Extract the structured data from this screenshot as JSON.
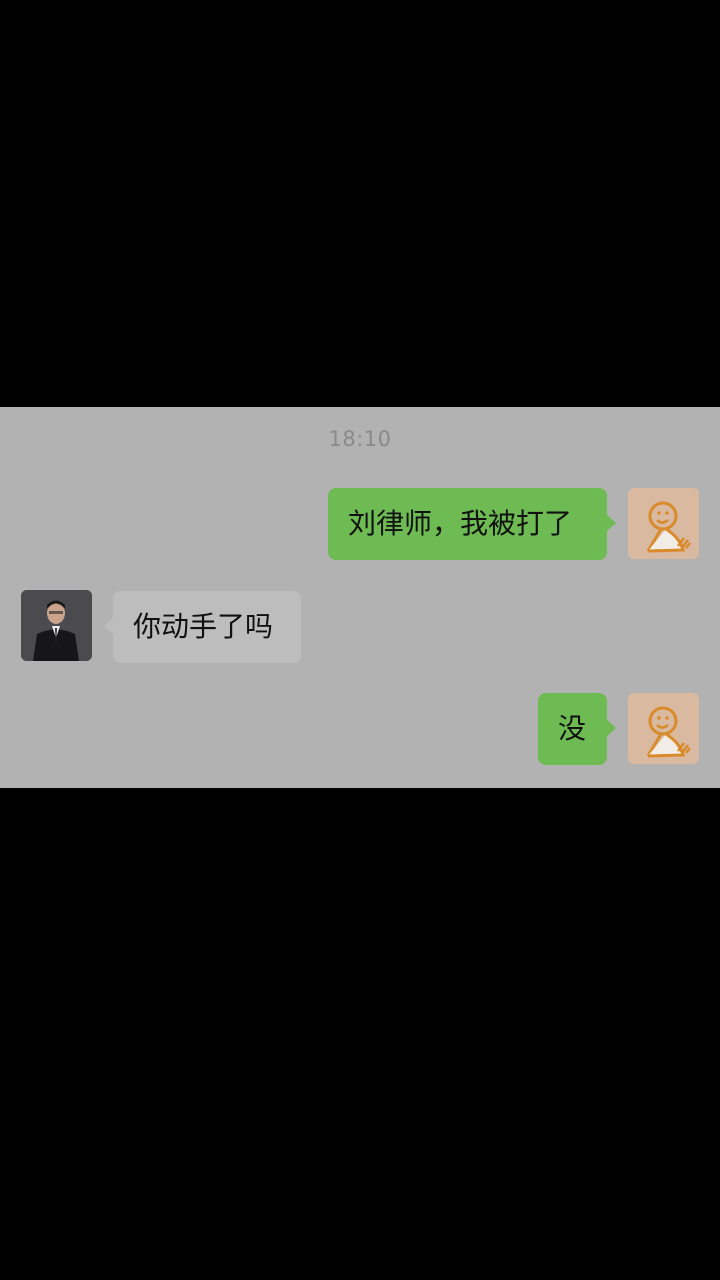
{
  "chat": {
    "timestamp": "18:10",
    "messages": [
      {
        "direction": "outgoing",
        "text": "刘律师，我被打了",
        "avatar_icon": "doodle-person-icon"
      },
      {
        "direction": "incoming",
        "text": "你动手了吗",
        "avatar_icon": "lawyer-avatar"
      },
      {
        "direction": "outgoing",
        "text": "没",
        "avatar_icon": "doodle-person-icon"
      }
    ]
  },
  "colors": {
    "chat_background": "#b2b2b2",
    "outgoing_bubble": "#6dbb52",
    "incoming_bubble": "#bdbdbd",
    "timestamp_text": "#8a8a8a",
    "letterbox": "#000000"
  }
}
